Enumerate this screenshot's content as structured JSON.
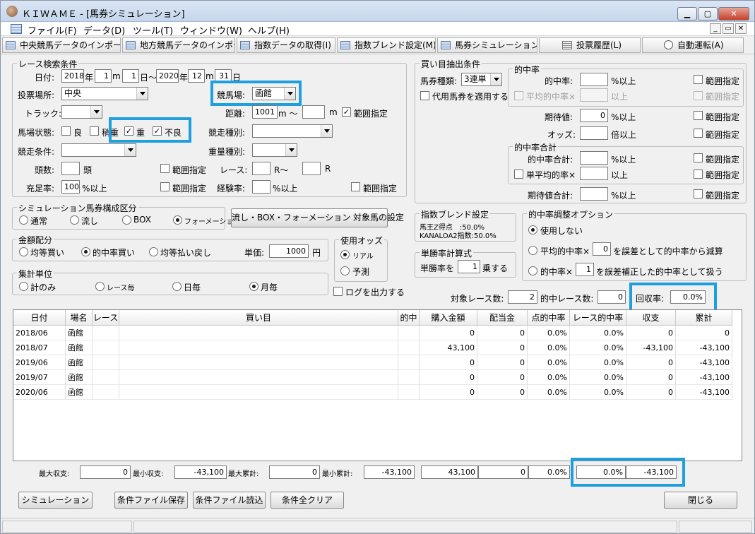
{
  "window": {
    "title": "ＫＩＷＡＭＥ - [馬券シミュレーション]"
  },
  "menu": [
    "ファイル(F)",
    "データ(D)",
    "ツール(T)",
    "ウィンドウ(W)",
    "ヘルプ(H)"
  ],
  "toolbar": [
    "中央競馬データのインポート(J)",
    "地方競馬データのインポート(N)",
    "指数データの取得(I)",
    "指数ブレンド設定(M)",
    "馬券シミュレーション(B)",
    "投票履歴(L)",
    "自動運転(A)"
  ],
  "race": {
    "legend": "レース検索条件",
    "date_label": "日付:",
    "from_year": "2018",
    "from_month": "1",
    "from_day": "1",
    "to_year": "2020",
    "to_month": "12",
    "to_day": "31",
    "y": "年",
    "m": "m",
    "d": "日",
    "tilde": "日～",
    "venue_label": "投票場所:",
    "venue": "中央",
    "course_label": "競馬場:",
    "course": "函館",
    "track_label": "トラック:",
    "distance_label": "距離:",
    "distance_from": "1001",
    "m_tilde": "m ～",
    "range": "範囲指定",
    "condition_label": "馬場状態:",
    "cond_good": "良",
    "cond_slight": "稍重",
    "cond_heavy": "重",
    "cond_bad": "不良",
    "type_label": "競走種別:",
    "cond2_label": "競走条件:",
    "weight_label": "重量種別:",
    "heads_label": "頭数:",
    "heads_unit": "頭",
    "race_label": "レース:",
    "race_r_tilde": "R～",
    "race_r": "R",
    "fill_label": "充足率:",
    "fill": "100",
    "fill_unit": "%以上",
    "exp_label": "経験率:",
    "exp_unit": "%以上"
  },
  "sim": {
    "legend": "シミュレーション馬券構成区分",
    "options": [
      "通常",
      "流し",
      "BOX",
      "フォーメーション"
    ],
    "button": "流し・BOX・フォーメーション 対象馬の設定"
  },
  "money": {
    "legend": "金額配分",
    "options": [
      "均等買い",
      "的中率買い",
      "均等払い戻し"
    ],
    "unit_label": "単価:",
    "unit": "1000",
    "yen": "円"
  },
  "odds": {
    "legend": "使用オッズ",
    "options": [
      "リアル",
      "予測"
    ]
  },
  "agg": {
    "legend": "集計単位",
    "options": [
      "計のみ",
      "レース毎",
      "日毎",
      "月毎"
    ]
  },
  "log_label": "ログを出力する",
  "buy": {
    "legend": "買い目抽出条件",
    "type_label": "馬券種類:",
    "type": "3連単",
    "substitute": "代用馬券を適用する",
    "hit": {
      "legend": "的中率",
      "rate_label": "的中率:",
      "rate_unit": "%以上",
      "avg_label": "平均的中率×",
      "avg_unit": "以上"
    },
    "expect_label": "期待値:",
    "expect": "0",
    "expect_unit": "%以上",
    "odds_label": "オッズ:",
    "odds_unit": "倍以上",
    "total": {
      "legend": "的中率合計",
      "sum_label": "的中率合計:",
      "sum_unit": "%以上",
      "avg_label": "単平均的率×",
      "avg_unit": "以上"
    },
    "exp_sum_label": "期待値合計:",
    "exp_sum_unit": "%以上",
    "range": "範囲指定"
  },
  "blend": {
    "legend": "指数ブレンド設定",
    "line1": "馬王Z得点　:50.0%",
    "line2": "KANALOA2指数:50.0%"
  },
  "win": {
    "legend": "単勝率計算式",
    "label": "単勝率を",
    "value": "1",
    "unit": "乗する"
  },
  "adjust": {
    "legend": "的中率調整オプション",
    "opt1": "使用しない",
    "opt2_a": "平均的中率×",
    "opt2_v": "0",
    "opt2_b": "を誤差として的中率から減算",
    "opt3_a": "的中率×",
    "opt3_v": "1",
    "opt3_b": "を誤差補正した的中率として扱う"
  },
  "counts": {
    "target_label": "対象レース数:",
    "target": "2",
    "hit_label": "的中レース数:",
    "hit": "0",
    "recovery_label": "回収率:",
    "recovery": "0.0%"
  },
  "table": {
    "headers": [
      "日付",
      "場名",
      "レース",
      "買い目",
      "的中",
      "購入金額",
      "配当金",
      "点的中率",
      "レース的中率",
      "収支",
      "累計"
    ],
    "rows": [
      [
        "2018/06",
        "函館",
        "",
        "",
        "",
        "0",
        "0",
        "0.0%",
        "0.0%",
        "0",
        "0"
      ],
      [
        "2018/07",
        "函館",
        "",
        "",
        "",
        "43,100",
        "0",
        "0.0%",
        "0.0%",
        "-43,100",
        "-43,100"
      ],
      [
        "2019/06",
        "函館",
        "",
        "",
        "",
        "0",
        "0",
        "0.0%",
        "0.0%",
        "0",
        "-43,100"
      ],
      [
        "2019/07",
        "函館",
        "",
        "",
        "",
        "0",
        "0",
        "0.0%",
        "0.0%",
        "0",
        "-43,100"
      ],
      [
        "2020/06",
        "函館",
        "",
        "",
        "",
        "0",
        "0",
        "0.0%",
        "0.0%",
        "0",
        "-43,100"
      ]
    ]
  },
  "summary": {
    "max_label": "最大収支:",
    "max": "0",
    "min_label": "最小収支:",
    "min": "-43,100",
    "maxcum_label": "最大累計:",
    "maxcum": "0",
    "mincum_label": "最小累計:",
    "mincum": "-43,100",
    "purchase": "43,100",
    "payout": "0",
    "point_rate": "0.0%",
    "race_rate": "0.0%",
    "balance": "-43,100"
  },
  "buttons": {
    "simulate": "シミュレーション",
    "save": "条件ファイル保存",
    "load": "条件ファイル読込",
    "clear": "条件全クリア",
    "close": "閉じる"
  }
}
